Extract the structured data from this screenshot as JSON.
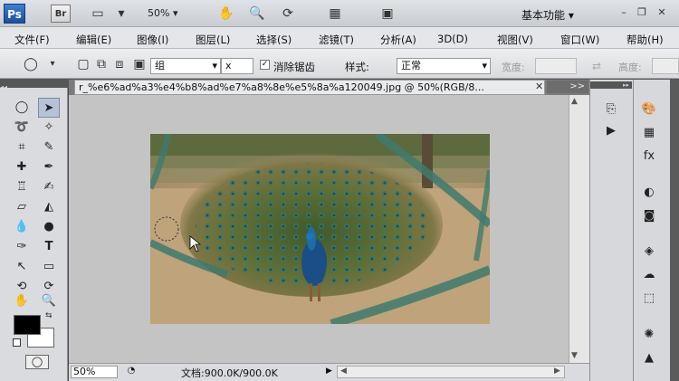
{
  "app": {
    "logo": "Ps",
    "bridge": "Br",
    "zoom": "50%",
    "workspace": "基本功能"
  },
  "menu": [
    "文件(F)",
    "编辑(E)",
    "图像(I)",
    "图层(L)",
    "选择(S)",
    "滤镜(T)",
    "分析(A)",
    "3D(D)",
    "视图(V)",
    "窗口(W)",
    "帮助(H)"
  ],
  "options": {
    "feather_value": "组",
    "feather_unit": "x",
    "antialias_label": "消除锯齿",
    "style_label": "样式:",
    "style_value": "正常",
    "width_label": "宽度:",
    "height_label": "高度:"
  },
  "document": {
    "tab_title": "r_%e6%ad%a3%e4%b8%ad%e7%a8%8e%e5%8a%a120049.jpg @ 50%(RGB/8...",
    "expand": ">>"
  },
  "status": {
    "zoom": "50%",
    "doc_info": "文档:900.0K/900.0K"
  },
  "colors": {
    "foreground": "#000000",
    "background": "#ffffff",
    "selection_tool_bg": "#b6c3d6"
  },
  "icons": {
    "window_minimize": "▭",
    "window_restore": "▭",
    "window_close": "✕"
  }
}
